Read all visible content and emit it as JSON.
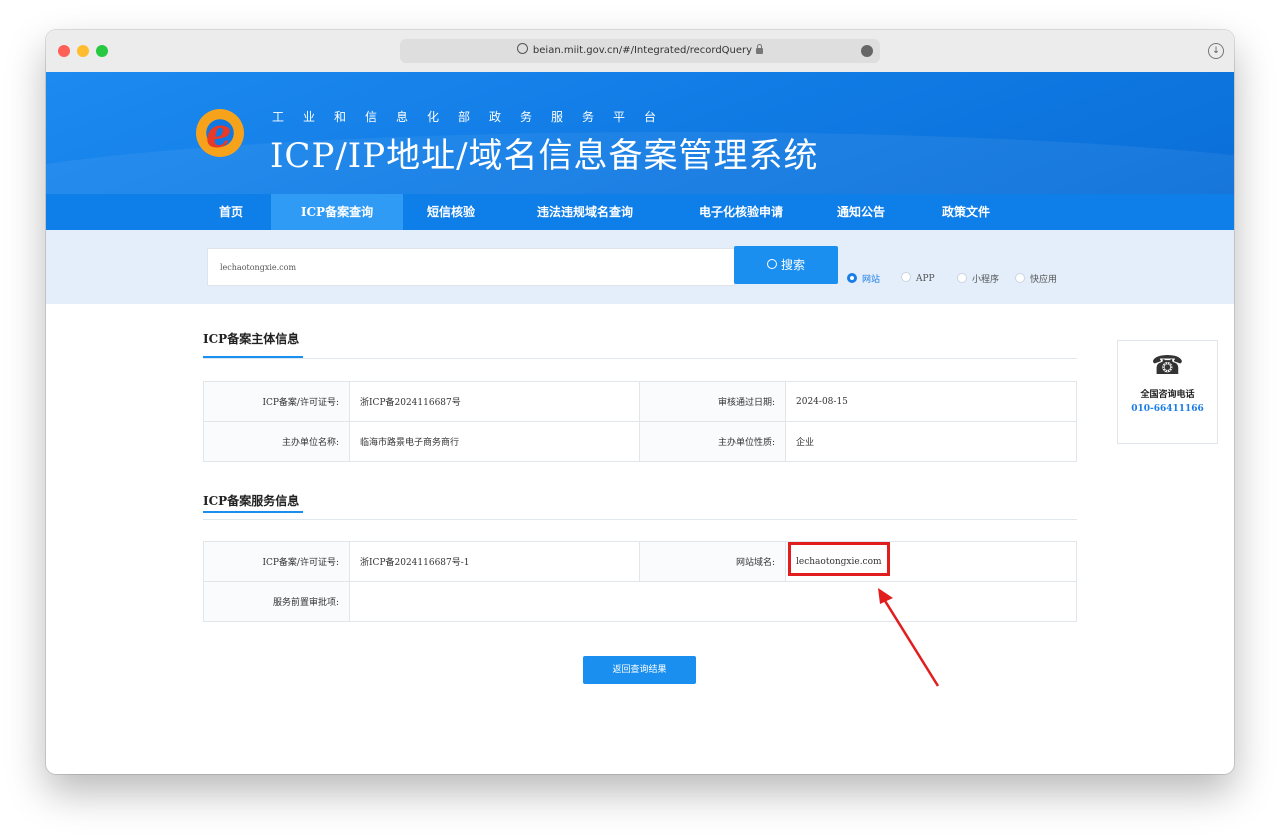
{
  "browser": {
    "url": "beian.miit.gov.cn/#/Integrated/recordQuery"
  },
  "header": {
    "subtitle": "工业和信息化部政务服务平台",
    "title": "ICP/IP地址/域名信息备案管理系统"
  },
  "nav": {
    "items": [
      {
        "label": "首页"
      },
      {
        "label": "ICP备案查询"
      },
      {
        "label": "短信核验"
      },
      {
        "label": "违法违规域名查询"
      },
      {
        "label": "电子化核验申请"
      },
      {
        "label": "通知公告"
      },
      {
        "label": "政策文件"
      }
    ],
    "active": "ICP备案查询"
  },
  "search": {
    "value": "lechaotongxie.com",
    "button_label": "搜索",
    "options": [
      {
        "label": "网站",
        "checked": true
      },
      {
        "label": "APP",
        "checked": false
      },
      {
        "label": "小程序",
        "checked": false
      },
      {
        "label": "快应用",
        "checked": false
      }
    ]
  },
  "subject_info": {
    "title": "ICP备案主体信息",
    "license_label": "ICP备案/许可证号:",
    "license_value": "浙ICP备2024116687号",
    "approval_date_label": "审核通过日期:",
    "approval_date_value": "2024-08-15",
    "org_name_label": "主办单位名称:",
    "org_name_value": "临海市路景电子商务商行",
    "org_type_label": "主办单位性质:",
    "org_type_value": "企业"
  },
  "service_info": {
    "title": "ICP备案服务信息",
    "license_label": "ICP备案/许可证号:",
    "license_value": "浙ICP备2024116687号-1",
    "domain_label": "网站域名:",
    "domain_value": "lechaotongxie.com",
    "pre_approval_label": "服务前置审批项:",
    "pre_approval_value": ""
  },
  "return_button": "返回查询结果",
  "hotline": {
    "icon": "telephone-icon",
    "label": "全国咨询电话",
    "number": "010-66411166"
  },
  "colors": {
    "brand_blue": "#1b8ff0",
    "nav_blue": "#0e7ee9",
    "highlight_red": "#e11d1d"
  }
}
